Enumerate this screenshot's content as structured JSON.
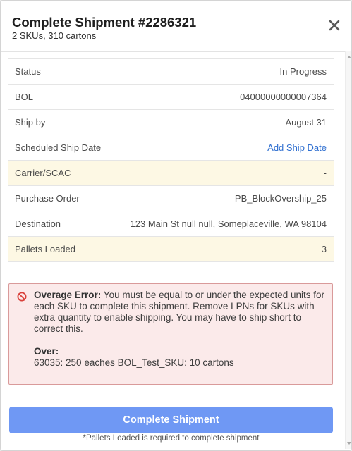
{
  "header": {
    "title": "Complete Shipment #2286321",
    "subtitle": "2 SKUs, 310 cartons",
    "close_icon": "close-icon"
  },
  "details": [
    {
      "label": "Status",
      "value": "In Progress",
      "highlight": false,
      "link": false
    },
    {
      "label": "BOL",
      "value": "04000000000007364",
      "highlight": false,
      "link": false
    },
    {
      "label": "Ship by",
      "value": "August 31",
      "highlight": false,
      "link": false
    },
    {
      "label": "Scheduled Ship Date",
      "value": "Add Ship Date",
      "highlight": false,
      "link": true
    },
    {
      "label": "Carrier/SCAC",
      "value": "-",
      "highlight": true,
      "link": false
    },
    {
      "label": "Purchase Order",
      "value": "PB_BlockOvership_25",
      "highlight": false,
      "link": false
    },
    {
      "label": "Destination",
      "value": "123 Main St null null, Someplaceville, WA 98104",
      "highlight": false,
      "link": false
    },
    {
      "label": "Pallets Loaded",
      "value": "3",
      "highlight": true,
      "link": false
    }
  ],
  "error": {
    "icon": "prohibited-icon",
    "title": "Overage Error:",
    "message": " You must be equal to or under the expected units for each SKU to complete this shipment. Remove LPNs for SKUs with extra quantity to enable shipping. You may have to ship short to correct this.",
    "over_title": "Over:",
    "over_items": [
      "63035: 250 eaches BOL_Test_SKU: 10 cartons"
    ]
  },
  "footer": {
    "button_label": "Complete Shipment",
    "note": "*Pallets Loaded is required to complete shipment"
  },
  "colors": {
    "highlight_row": "#fdf8e4",
    "link": "#2f6fd0",
    "error_bg": "#fbeaea",
    "error_border": "#d99a9a",
    "error_icon": "#d9403a",
    "button": "#6f98f4"
  }
}
